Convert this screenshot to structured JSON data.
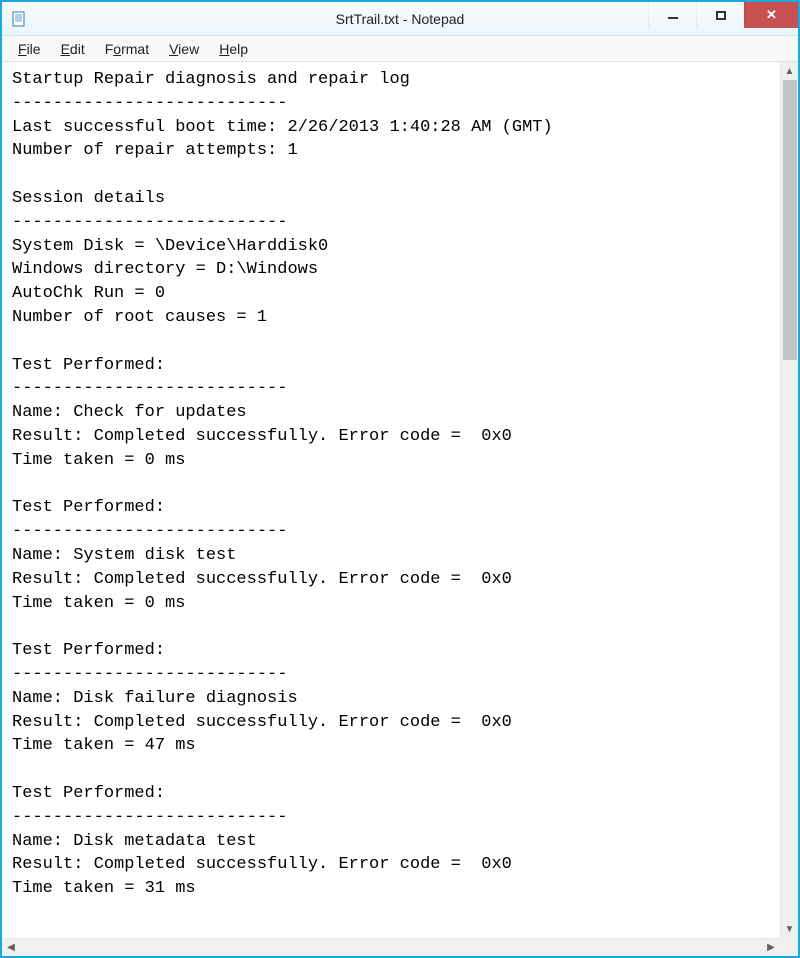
{
  "window": {
    "title": "SrtTrail.txt - Notepad"
  },
  "menu": {
    "file": "File",
    "edit": "Edit",
    "format": "Format",
    "view": "View",
    "help": "Help"
  },
  "content": {
    "text": "Startup Repair diagnosis and repair log\n---------------------------\nLast successful boot time: 2/26/2013 1:40:28 AM (GMT)\nNumber of repair attempts: 1\n\nSession details\n---------------------------\nSystem Disk = \\Device\\Harddisk0\nWindows directory = D:\\Windows\nAutoChk Run = 0\nNumber of root causes = 1\n\nTest Performed:\n---------------------------\nName: Check for updates\nResult: Completed successfully. Error code =  0x0\nTime taken = 0 ms\n\nTest Performed:\n---------------------------\nName: System disk test\nResult: Completed successfully. Error code =  0x0\nTime taken = 0 ms\n\nTest Performed:\n---------------------------\nName: Disk failure diagnosis\nResult: Completed successfully. Error code =  0x0\nTime taken = 47 ms\n\nTest Performed:\n---------------------------\nName: Disk metadata test\nResult: Completed successfully. Error code =  0x0\nTime taken = 31 ms"
  }
}
